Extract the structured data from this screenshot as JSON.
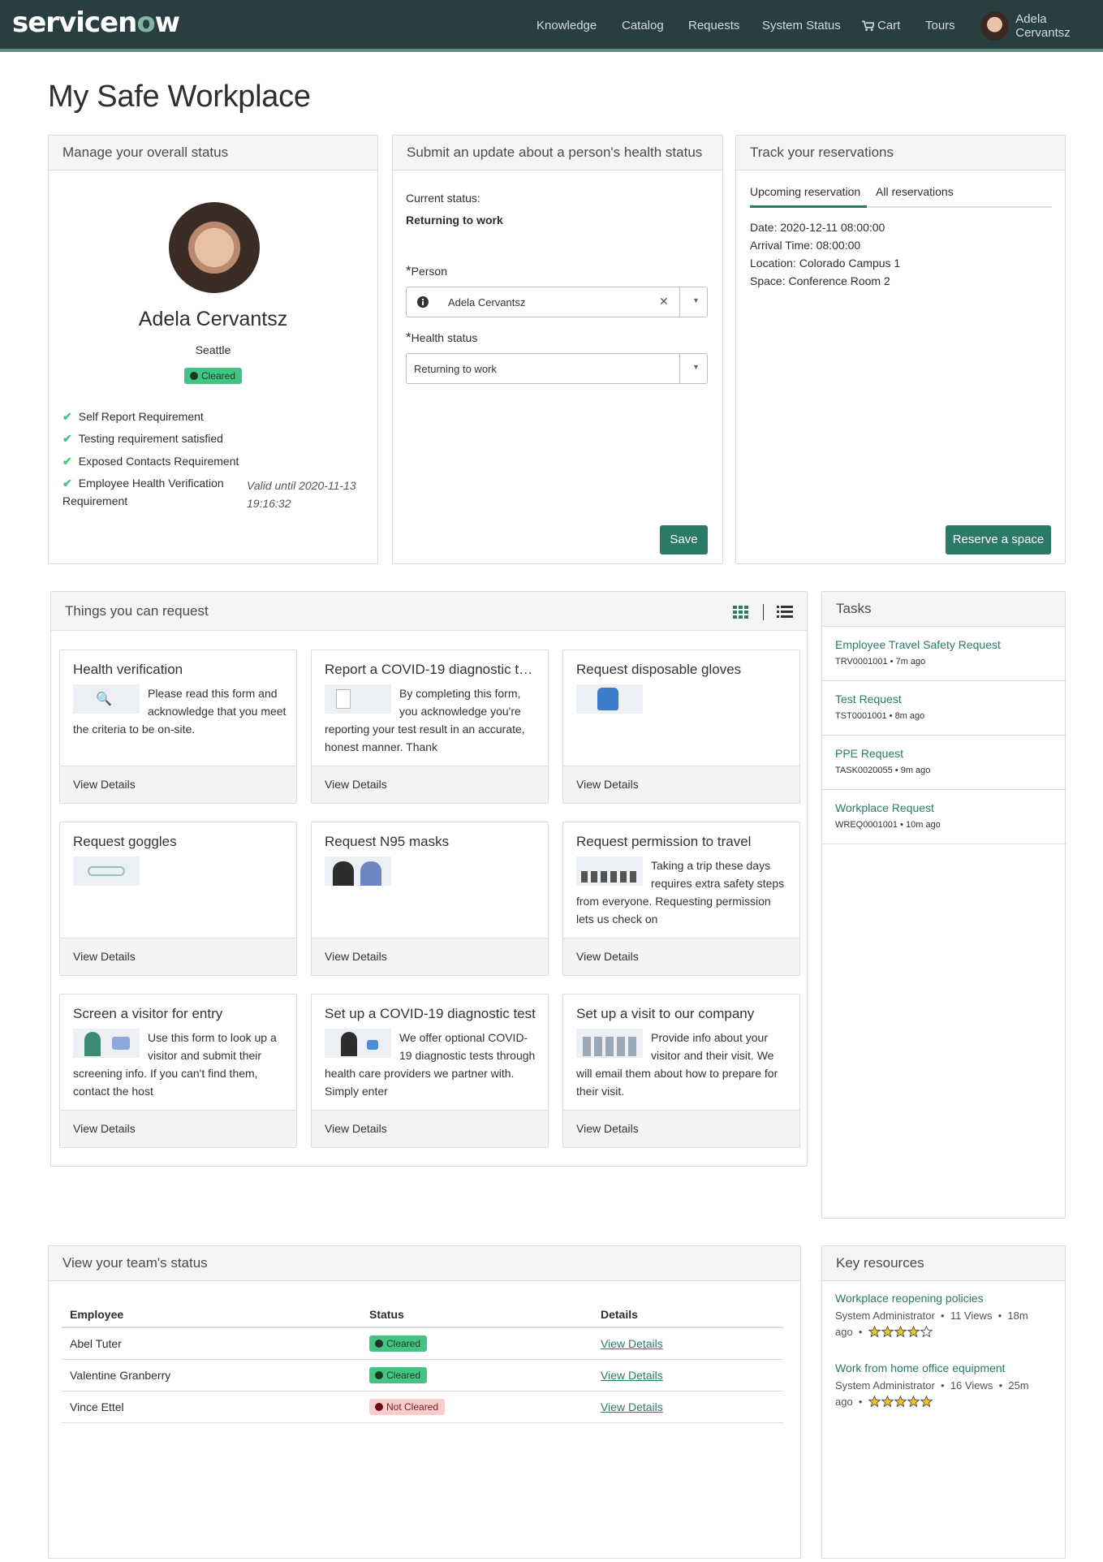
{
  "header": {
    "logo_left": "servicen",
    "logo_o": "o",
    "logo_right": "w",
    "nav": [
      "Knowledge",
      "Catalog",
      "Requests",
      "System Status",
      "Cart",
      "Tours"
    ],
    "user_name": "Adela Cervantsz"
  },
  "page_title": "My Safe Workplace",
  "status_panel": {
    "title": "Manage your overall status",
    "name": "Adela Cervantsz",
    "location": "Seattle",
    "badge": "Cleared",
    "requirements": [
      "Self Report Requirement",
      "Testing requirement satisfied",
      "Exposed Contacts Requirement",
      "Employee Health Verification"
    ],
    "requirement_4_line2": "Requirement",
    "valid_line1": "Valid until 2020-11-13",
    "valid_line2": "19:16:32"
  },
  "health_panel": {
    "title": "Submit an update about a person's health status",
    "current_status_label": "Current status:",
    "current_status_value": "Returning to work",
    "person_label": "Person",
    "person_value": "Adela Cervantsz",
    "health_label": "Health status",
    "health_value": "Returning to work",
    "required_mark": "*",
    "save_label": "Save"
  },
  "reservations_panel": {
    "title": "Track your reservations",
    "tabs": [
      "Upcoming reservation",
      "All reservations"
    ],
    "details": [
      "Date: 2020-12-11 08:00:00",
      "Arrival Time: 08:00:00",
      "Location: Colorado Campus 1",
      "Space: Conference Room 2"
    ],
    "reserve_label": "Reserve a space"
  },
  "requests_panel": {
    "title": "Things you can request",
    "view_details": "View Details",
    "cards": [
      {
        "title": "Health verification",
        "desc": "Please read this form and acknowledge that you meet the criteria to be on-site."
      },
      {
        "title": "Report a COVID-19 diagnostic tes…",
        "desc": "By completing this form, you acknowledge you're reporting your test result in an accurate, honest manner. Thank"
      },
      {
        "title": "Request disposable gloves",
        "desc": ""
      },
      {
        "title": "Request goggles",
        "desc": ""
      },
      {
        "title": "Request N95 masks",
        "desc": ""
      },
      {
        "title": "Request permission to travel",
        "desc": "Taking a trip these days requires extra safety steps from everyone. Requesting permission lets us check on"
      },
      {
        "title": "Screen a visitor for entry",
        "desc": "Use this form to look up a visitor and submit their screening info. If you can't find them, contact the host"
      },
      {
        "title": "Set up a COVID-19 diagnostic test",
        "desc": "We offer optional COVID-19 diagnostic tests through health care providers we partner with. Simply enter"
      },
      {
        "title": "Set up a visit to our company",
        "desc": "Provide info about your visitor and their visit. We will email them about how to prepare for their visit."
      }
    ]
  },
  "tasks_panel": {
    "title": "Tasks",
    "items": [
      {
        "title": "Employee Travel Safety Request",
        "sub": "TRV0001001 • 7m ago"
      },
      {
        "title": "Test Request",
        "sub": "TST0001001 • 8m ago"
      },
      {
        "title": "PPE Request",
        "sub": "TASK0020055 • 9m ago"
      },
      {
        "title": "Workplace Request",
        "sub": "WREQ0001001 • 10m ago"
      }
    ]
  },
  "team_panel": {
    "title": "View your team's status",
    "columns": [
      "Employee",
      "Status",
      "Details"
    ],
    "rows": [
      {
        "employee": "Abel Tuter",
        "status": "Cleared",
        "details": "View Details"
      },
      {
        "employee": "Valentine Granberry",
        "status": "Cleared",
        "details": "View Details"
      },
      {
        "employee": "Vince Ettel",
        "status": "Not Cleared",
        "details": "View Details"
      }
    ]
  },
  "resources_panel": {
    "title": "Key resources",
    "items": [
      {
        "title": "Workplace reopening policies",
        "author": "System Administrator",
        "views": "11 Views",
        "age": "18m",
        "age2": "ago",
        "rating": 4
      },
      {
        "title": "Work from home office equipment",
        "author": "System Administrator",
        "views": "16 Views",
        "age": "25m",
        "age2": "ago",
        "rating": 5
      }
    ]
  },
  "colors": {
    "header_bg": "#293e40",
    "accent": "#2b7a67",
    "cleared": "#43c482",
    "not_cleared_bg": "#f9cdcd"
  }
}
